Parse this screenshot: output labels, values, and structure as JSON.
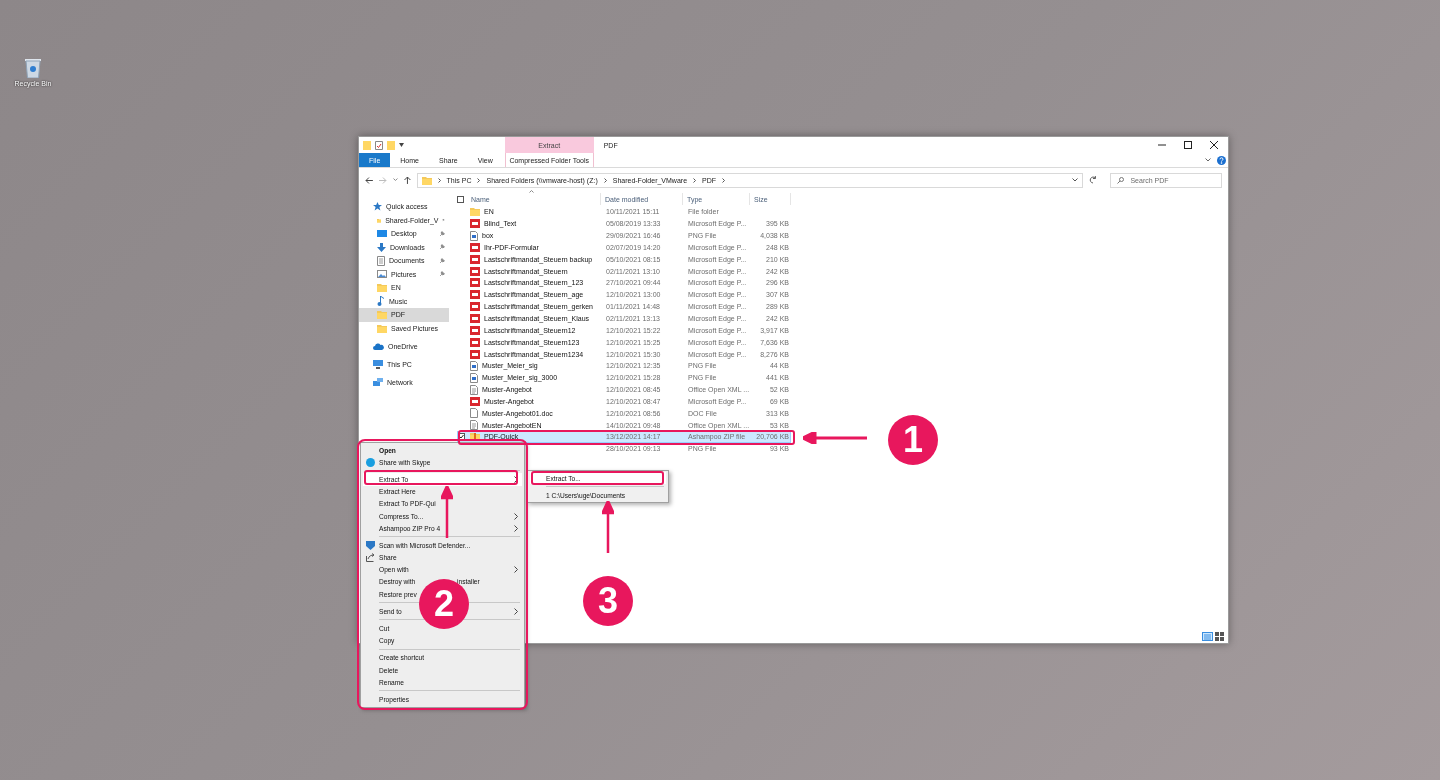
{
  "desktop": {
    "icons": [
      {
        "label": "Recycle Bin",
        "kind": "recycle"
      }
    ]
  },
  "window": {
    "title": "PDF",
    "tabs": [
      {
        "label": "File",
        "kind": "file"
      },
      {
        "label": "Home",
        "kind": "plain"
      },
      {
        "label": "Share",
        "kind": "plain"
      },
      {
        "label": "View",
        "kind": "plain"
      },
      {
        "label": "Compressed Folder Tools",
        "kind": "context",
        "group": "Extract"
      }
    ],
    "address": {
      "crumbs": [
        "This PC",
        "Shared Folders (\\\\vmware-host) (Z:)",
        "Shared-Folder_VMware",
        "PDF"
      ]
    },
    "search": {
      "placeholder": "Search PDF"
    },
    "nav": [
      {
        "label": "Quick access",
        "kind": "star",
        "selected": false,
        "children": [
          {
            "label": "Shared-Folder_V",
            "kind": "folder",
            "pinned": true,
            "selected": false
          },
          {
            "label": "Desktop",
            "kind": "desktop",
            "pinned": true,
            "selected": false
          },
          {
            "label": "Downloads",
            "kind": "download",
            "pinned": true,
            "selected": false
          },
          {
            "label": "Documents",
            "kind": "documents",
            "pinned": true,
            "selected": false
          },
          {
            "label": "Pictures",
            "kind": "pictures",
            "pinned": true,
            "selected": false
          },
          {
            "label": "EN",
            "kind": "folder",
            "pinned": false,
            "selected": false
          },
          {
            "label": "Music",
            "kind": "music",
            "pinned": false,
            "selected": false
          },
          {
            "label": "PDF",
            "kind": "folder",
            "pinned": false,
            "selected": true
          },
          {
            "label": "Saved Pictures",
            "kind": "folder",
            "pinned": false,
            "selected": false
          }
        ]
      },
      {
        "label": "OneDrive",
        "kind": "cloud",
        "selected": false
      },
      {
        "label": "This PC",
        "kind": "pc",
        "selected": false
      },
      {
        "label": "Network",
        "kind": "network",
        "selected": false
      }
    ],
    "header_checkbox": {
      "checked": false
    },
    "columns": [
      "Name",
      "Date modified",
      "Type",
      "Size"
    ],
    "rows": [
      {
        "name": "EN",
        "date": "10/11/2021 15:11",
        "type": "File folder",
        "kind": "folder",
        "selected": false
      },
      {
        "name": "Blind_Text",
        "date": "05/08/2019 13:33",
        "type": "Microsoft Edge P...",
        "size": "395 KB",
        "kind": "pdf",
        "selected": false
      },
      {
        "name": "box",
        "date": "29/09/2021 16:46",
        "type": "PNG File",
        "size": "4,038 KB",
        "kind": "png",
        "selected": false
      },
      {
        "name": "Ihr-PDF-Formular",
        "date": "02/07/2019 14:20",
        "type": "Microsoft Edge P...",
        "size": "248 KB",
        "kind": "pdf",
        "selected": false
      },
      {
        "name": "Lastschriftmandat_Steuern backup",
        "date": "05/10/2021 08:15",
        "type": "Microsoft Edge P...",
        "size": "210 KB",
        "kind": "pdf",
        "selected": false
      },
      {
        "name": "Lastschriftmandat_Steuern",
        "date": "02/11/2021 13:10",
        "type": "Microsoft Edge P...",
        "size": "242 KB",
        "kind": "pdf",
        "selected": false
      },
      {
        "name": "Lastschriftmandat_Steuern_123",
        "date": "27/10/2021 09:44",
        "type": "Microsoft Edge P...",
        "size": "296 KB",
        "kind": "pdf",
        "selected": false
      },
      {
        "name": "Lastschriftmandat_Steuern_age",
        "date": "12/10/2021 13:00",
        "type": "Microsoft Edge P...",
        "size": "307 KB",
        "kind": "pdf",
        "selected": false
      },
      {
        "name": "Lastschriftmandat_Steuern_gerken",
        "date": "01/11/2021 14:48",
        "type": "Microsoft Edge P...",
        "size": "289 KB",
        "kind": "pdf",
        "selected": false
      },
      {
        "name": "Lastschriftmandat_Steuern_Klaus",
        "date": "02/11/2021 13:13",
        "type": "Microsoft Edge P...",
        "size": "242 KB",
        "kind": "pdf",
        "selected": false
      },
      {
        "name": "Lastschriftmandat_Steuern12",
        "date": "12/10/2021 15:22",
        "type": "Microsoft Edge P...",
        "size": "3,917 KB",
        "kind": "pdf",
        "selected": false
      },
      {
        "name": "Lastschriftmandat_Steuern123",
        "date": "12/10/2021 15:25",
        "type": "Microsoft Edge P...",
        "size": "7,636 KB",
        "kind": "pdf",
        "selected": false
      },
      {
        "name": "Lastschriftmandat_Steuern1234",
        "date": "12/10/2021 15:30",
        "type": "Microsoft Edge P...",
        "size": "8,276 KB",
        "kind": "pdf",
        "selected": false
      },
      {
        "name": "Muster_Meier_sig",
        "date": "12/10/2021 12:35",
        "type": "PNG File",
        "size": "44 KB",
        "kind": "png",
        "selected": false
      },
      {
        "name": "Muster_Meier_sig_3000",
        "date": "12/10/2021 15:28",
        "type": "PNG File",
        "size": "441 KB",
        "kind": "png",
        "selected": false
      },
      {
        "name": "Muster-Angebot",
        "date": "12/10/2021 08:45",
        "type": "Office Open XML ...",
        "size": "52 KB",
        "kind": "doc",
        "selected": false
      },
      {
        "name": "Muster-Angebot",
        "date": "12/10/2021 08:47",
        "type": "Microsoft Edge P...",
        "size": "69 KB",
        "kind": "pdf",
        "selected": false
      },
      {
        "name": "Muster-Angebot01.doc",
        "date": "12/10/2021 08:56",
        "type": "DOC File",
        "size": "313 KB",
        "kind": "page",
        "selected": false
      },
      {
        "name": "Muster-AngebotEN",
        "date": "14/10/2021 09:48",
        "type": "Office Open XML ...",
        "size": "53 KB",
        "kind": "doc",
        "selected": false
      },
      {
        "name": "PDF-Quick",
        "date": "13/12/2021 14:17",
        "type": "Ashampoo ZIP file",
        "size": "20,706 KB",
        "kind": "zip",
        "selected": true
      },
      {
        "date": "28/10/2021 09:13",
        "type": "PNG File",
        "size": "93 KB",
        "selected": false
      }
    ]
  },
  "context_menu": {
    "items": [
      {
        "kind": "item",
        "label": "Open",
        "bold": true
      },
      {
        "kind": "skype",
        "label": "Share with Skype"
      },
      {
        "kind": "separator"
      },
      {
        "kind": "item",
        "label": "Extract To",
        "submenu": true,
        "highlighted": true
      },
      {
        "kind": "item",
        "label": "Extract Here"
      },
      {
        "kind": "item",
        "label": "Extract To PDF-Qui"
      },
      {
        "kind": "item",
        "label": "Compress To...",
        "submenu": true
      },
      {
        "kind": "item",
        "label": "Ashampoo ZIP Pro 4",
        "submenu": true
      },
      {
        "kind": "separator"
      },
      {
        "kind": "defender",
        "label": "Scan with Microsoft Defender..."
      },
      {
        "kind": "share",
        "label": "Share"
      },
      {
        "kind": "item",
        "label": "Open with",
        "submenu": true
      },
      {
        "kind": "item",
        "label": "Destroy with",
        "tail": "installer"
      },
      {
        "kind": "item",
        "label": "Restore prev"
      },
      {
        "kind": "separator"
      },
      {
        "kind": "item",
        "label": "Send to",
        "submenu": true
      },
      {
        "kind": "separator"
      },
      {
        "kind": "item",
        "label": "Cut"
      },
      {
        "kind": "item",
        "label": "Copy"
      },
      {
        "kind": "separator"
      },
      {
        "kind": "item",
        "label": "Create shortcut"
      },
      {
        "kind": "item",
        "label": "Delete"
      },
      {
        "kind": "item",
        "label": "Rename"
      },
      {
        "kind": "separator"
      },
      {
        "kind": "item",
        "label": "Properties"
      }
    ]
  },
  "submenu": {
    "items": [
      {
        "kind": "item",
        "label": "Extract To...",
        "highlighted": true
      },
      {
        "kind": "separator"
      },
      {
        "kind": "item",
        "label": "1 C:\\Users\\uge\\Documents"
      }
    ]
  },
  "annotations": [
    {
      "label": "1"
    },
    {
      "label": "2"
    },
    {
      "label": "3"
    }
  ]
}
